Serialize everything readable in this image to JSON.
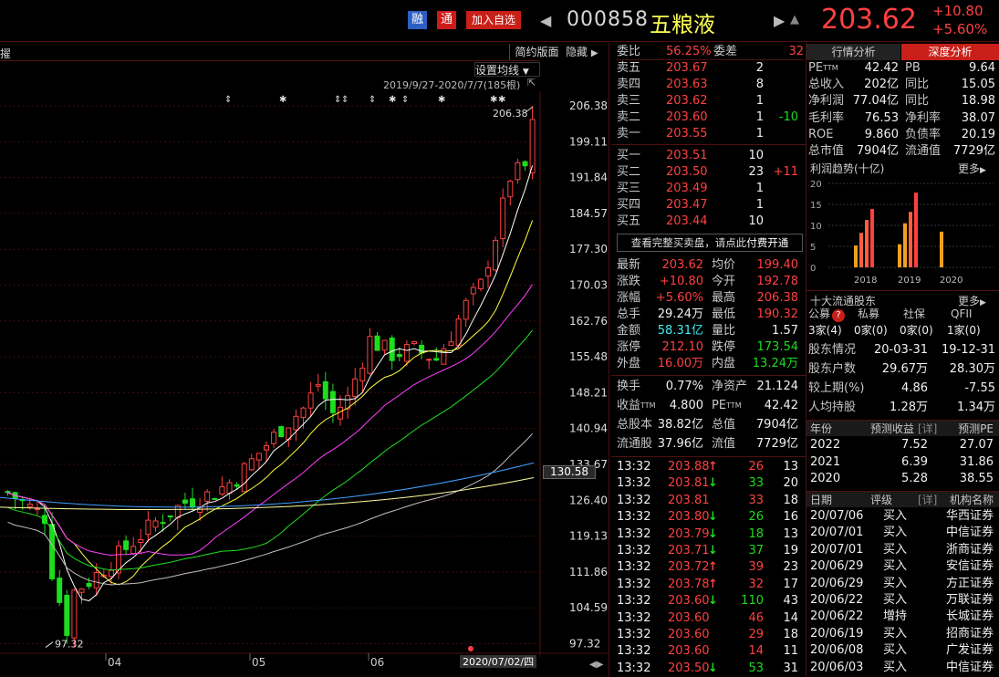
{
  "header": {
    "rong": "融",
    "tong": "通",
    "add_watch": "加入自选",
    "code": "000858",
    "name": "五粮液",
    "price": "203.62",
    "change": "+10.80",
    "change_pct": "+5.60%"
  },
  "chart": {
    "simple_layout": "简约版面",
    "hide": "隐藏",
    "set_ma": "设置均线",
    "range": "2019/9/27-2020/7/7(185根)",
    "left_label": "擢",
    "price_ticks": [
      "206.38",
      "199.11",
      "191.84",
      "184.57",
      "177.30",
      "170.03",
      "162.76",
      "155.48",
      "148.21",
      "140.94",
      "133.67",
      "126.40",
      "119.13",
      "111.86",
      "104.59",
      "97.32"
    ],
    "current_label": "130.58",
    "max_label": "206.38",
    "min_label": "97.32",
    "x_ticks": [
      "04",
      "05",
      "06"
    ],
    "date_label": "2020/07/02/四"
  },
  "order": {
    "weibi_label": "委比",
    "weibi": "56.25%",
    "weicha_label": "委差",
    "weicha": "32",
    "asks": [
      {
        "label": "卖五",
        "price": "203.67",
        "vol": "2",
        "chg": ""
      },
      {
        "label": "卖四",
        "price": "203.63",
        "vol": "8",
        "chg": ""
      },
      {
        "label": "卖三",
        "price": "203.62",
        "vol": "1",
        "chg": ""
      },
      {
        "label": "卖二",
        "price": "203.60",
        "vol": "1",
        "chg": "-10"
      },
      {
        "label": "卖一",
        "price": "203.55",
        "vol": "1",
        "chg": ""
      }
    ],
    "bids": [
      {
        "label": "买一",
        "price": "203.51",
        "vol": "10",
        "chg": ""
      },
      {
        "label": "买二",
        "price": "203.50",
        "vol": "23",
        "chg": "+11"
      },
      {
        "label": "买三",
        "price": "203.49",
        "vol": "1",
        "chg": ""
      },
      {
        "label": "买四",
        "price": "203.47",
        "vol": "1",
        "chg": ""
      },
      {
        "label": "买五",
        "price": "203.44",
        "vol": "10",
        "chg": ""
      }
    ],
    "promo": "查看完整买卖盘，请点此",
    "promo_link": "付费开通"
  },
  "quote": [
    {
      "l1": "最新",
      "v1": "203.62",
      "c1": "red",
      "l2": "均价",
      "v2": "199.40",
      "c2": "red"
    },
    {
      "l1": "涨跌",
      "v1": "+10.80",
      "c1": "red",
      "l2": "今开",
      "v2": "192.78",
      "c2": "red"
    },
    {
      "l1": "涨幅",
      "v1": "+5.60%",
      "c1": "red",
      "l2": "最高",
      "v2": "206.38",
      "c2": "red"
    },
    {
      "l1": "总手",
      "v1": "29.24万",
      "c1": "wht",
      "l2": "最低",
      "v2": "190.32",
      "c2": "red"
    },
    {
      "l1": "金额",
      "v1": "58.31亿",
      "c1": "cyan",
      "l2": "量比",
      "v2": "1.57",
      "c2": "wht"
    },
    {
      "l1": "涨停",
      "v1": "212.10",
      "c1": "red",
      "l2": "跌停",
      "v2": "173.54",
      "c2": "green"
    },
    {
      "l1": "外盘",
      "v1": "16.00万",
      "c1": "red",
      "l2": "内盘",
      "v2": "13.24万",
      "c2": "green"
    }
  ],
  "quote2": [
    {
      "l1": "换手",
      "v1": "0.77%",
      "l2": "净资产",
      "v2": "21.124"
    },
    {
      "l1": "收益",
      "s1": "TTM",
      "v1": "4.800",
      "l2": "PE",
      "s2": "TTM",
      "v2": "42.42"
    },
    {
      "l1": "总股本",
      "v1": "38.82亿",
      "l2": "总值",
      "v2": "7904亿"
    },
    {
      "l1": "流通股",
      "v1": "37.96亿",
      "l2": "流值",
      "v2": "7729亿"
    }
  ],
  "ticks": [
    {
      "t": "13:32",
      "p": "203.88",
      "d": "up",
      "v": "26",
      "n": "13"
    },
    {
      "t": "13:32",
      "p": "203.81",
      "d": "down",
      "v": "33",
      "n": "20"
    },
    {
      "t": "13:32",
      "p": "203.81",
      "d": "none",
      "v": "33",
      "n": "18"
    },
    {
      "t": "13:32",
      "p": "203.80",
      "d": "down",
      "v": "26",
      "n": "16"
    },
    {
      "t": "13:32",
      "p": "203.79",
      "d": "down",
      "v": "18",
      "n": "13"
    },
    {
      "t": "13:32",
      "p": "203.71",
      "d": "down",
      "v": "37",
      "n": "19"
    },
    {
      "t": "13:32",
      "p": "203.72",
      "d": "up",
      "v": "39",
      "n": "23"
    },
    {
      "t": "13:32",
      "p": "203.78",
      "d": "up",
      "v": "32",
      "n": "17"
    },
    {
      "t": "13:32",
      "p": "203.60",
      "d": "down",
      "v": "110",
      "n": "43"
    },
    {
      "t": "13:32",
      "p": "203.60",
      "d": "none",
      "v": "46",
      "n": "14"
    },
    {
      "t": "13:32",
      "p": "203.60",
      "d": "none",
      "v": "29",
      "n": "18"
    },
    {
      "t": "13:32",
      "p": "203.60",
      "d": "none",
      "v": "14",
      "n": "11"
    },
    {
      "t": "13:32",
      "p": "203.50",
      "d": "down",
      "v": "53",
      "n": "31"
    }
  ],
  "right": {
    "tab1": "行情分析",
    "tab2": "深度分析",
    "fin": [
      {
        "l1": "PE",
        "s1": "TTM",
        "v1": "42.42",
        "l2": "PB",
        "v2": "9.64"
      },
      {
        "l1": "总收入",
        "v1": "202亿",
        "l2": "同比",
        "v2": "15.05"
      },
      {
        "l1": "净利润",
        "v1": "77.04亿",
        "l2": "同比",
        "v2": "18.98"
      },
      {
        "l1": "毛利率",
        "v1": "76.53",
        "l2": "净利率",
        "v2": "38.07"
      },
      {
        "l1": "ROE",
        "v1": "9.860",
        "l2": "负债率",
        "v2": "20.19"
      },
      {
        "l1": "总市值",
        "v1": "7904亿",
        "l2": "流通值",
        "v2": "7729亿"
      }
    ],
    "profit_title": "利润趋势(十亿)",
    "more": "更多",
    "profit_yticks": [
      "20",
      "15",
      "10",
      "5",
      "0"
    ],
    "profit_years": [
      "2018",
      "2019",
      "2020"
    ],
    "holders_title": "十大流通股东",
    "holder_types": [
      "公募",
      "私募",
      "社保",
      "QFII"
    ],
    "holder_counts": [
      "3家(4)",
      "0家(0)",
      "0家(0)",
      "1家(0)"
    ],
    "holder_rows": [
      {
        "l": "股东情况",
        "a": "20-03-31",
        "b": "19-12-31"
      },
      {
        "l": "股东户数",
        "a": "29.67万",
        "b": "28.30万"
      },
      {
        "l": "较上期(%)",
        "a": "4.86",
        "b": "-7.55"
      },
      {
        "l": "人均持股",
        "a": "1.28万",
        "b": "1.34万"
      }
    ],
    "fc_headers": [
      "年份",
      "预测收益",
      "[详]",
      "预测PE"
    ],
    "forecast": [
      {
        "y": "2022",
        "e": "7.52",
        "pe": "27.07"
      },
      {
        "y": "2021",
        "e": "6.39",
        "pe": "31.86"
      },
      {
        "y": "2020",
        "e": "5.28",
        "pe": "38.55"
      }
    ],
    "rt_headers": [
      "日期",
      "评级",
      "[详]",
      "机构名称"
    ],
    "ratings": [
      {
        "d": "20/07/06",
        "r": "买入",
        "o": "华西证券"
      },
      {
        "d": "20/07/01",
        "r": "买入",
        "o": "中信证券"
      },
      {
        "d": "20/07/01",
        "r": "买入",
        "o": "浙商证券"
      },
      {
        "d": "20/06/29",
        "r": "买入",
        "o": "安信证券"
      },
      {
        "d": "20/06/29",
        "r": "买入",
        "o": "方正证券"
      },
      {
        "d": "20/06/22",
        "r": "买入",
        "o": "万联证券"
      },
      {
        "d": "20/06/22",
        "r": "增持",
        "o": "长城证券"
      },
      {
        "d": "20/06/19",
        "r": "买入",
        "o": "招商证券"
      },
      {
        "d": "20/06/08",
        "r": "买入",
        "o": "广发证券"
      },
      {
        "d": "20/06/03",
        "r": "买入",
        "o": "中信证券"
      }
    ]
  },
  "colors": {
    "up": "#ff4040",
    "down": "#1edc1e",
    "bg": "#000000",
    "grid": "#3a0f0f",
    "ma1": "#ffffff",
    "ma2": "#ffff40",
    "ma3": "#ff40ff",
    "ma4": "#20e020",
    "ma5": "#c0c0c0",
    "ma6": "#40a0ff",
    "ma7": "#ffffa0"
  }
}
